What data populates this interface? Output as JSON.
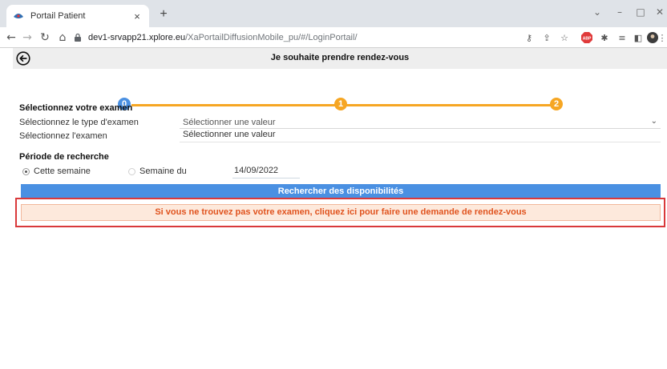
{
  "browser": {
    "tab_title": "Portail Patient",
    "tab_close": "×",
    "new_tab": "+",
    "url_host": "dev1-srvapp21.xplore.eu",
    "url_path": "/XaPortailDiffusionMobile_pu/#/LoginPortail/",
    "window_controls": {
      "dropdown": "⌄",
      "minimize": "–",
      "maximize": "□",
      "close": "✕"
    }
  },
  "header": {
    "title": "Je souhaite prendre rendez-vous"
  },
  "stepper": {
    "steps": [
      "0",
      "1",
      "2"
    ]
  },
  "exam_section": {
    "title": "Sélectionnez votre examen",
    "type_label": "Sélectionnez le type d'examen",
    "type_value": "Sélectionner une valeur",
    "exam_label": "Sélectionnez l'examen",
    "exam_value": "Sélectionner une valeur"
  },
  "period_section": {
    "title": "Période de recherche",
    "option_this_week": "Cette semaine",
    "option_week_of": "Semaine du",
    "date_value": "14/09/2022",
    "selected": "Cette semaine"
  },
  "actions": {
    "search_label": "Rechercher des disponibilités",
    "request_label": "Si vous ne trouvez pas votre examen, cliquez ici pour faire une demande de rendez-vous"
  },
  "colors": {
    "primary_blue": "#4a90e2",
    "step_orange": "#f6a623",
    "request_text": "#e0531e",
    "request_bg": "#fde9dc",
    "highlight_red": "#d9393b"
  }
}
